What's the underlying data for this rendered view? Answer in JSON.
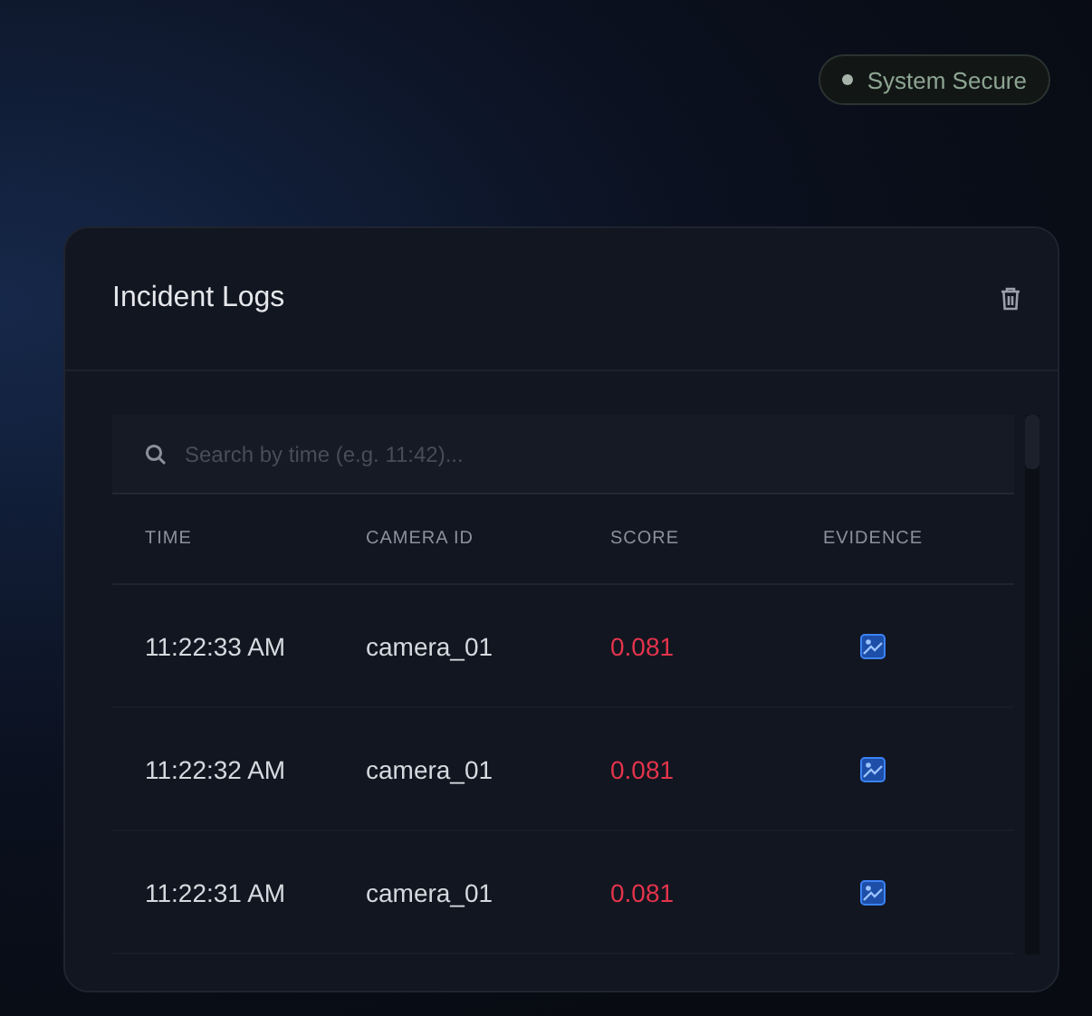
{
  "status_badge": {
    "label": "System Secure"
  },
  "panel": {
    "title": "Incident Logs",
    "search": {
      "placeholder": "Search by time (e.g. 11:42)..."
    },
    "table": {
      "columns": [
        "TIME",
        "CAMERA ID",
        "SCORE",
        "EVIDENCE"
      ],
      "rows": [
        {
          "time": "11:22:33 AM",
          "camera_id": "camera_01",
          "score": "0.081"
        },
        {
          "time": "11:22:32 AM",
          "camera_id": "camera_01",
          "score": "0.081"
        },
        {
          "time": "11:22:31 AM",
          "camera_id": "camera_01",
          "score": "0.081"
        }
      ]
    }
  }
}
